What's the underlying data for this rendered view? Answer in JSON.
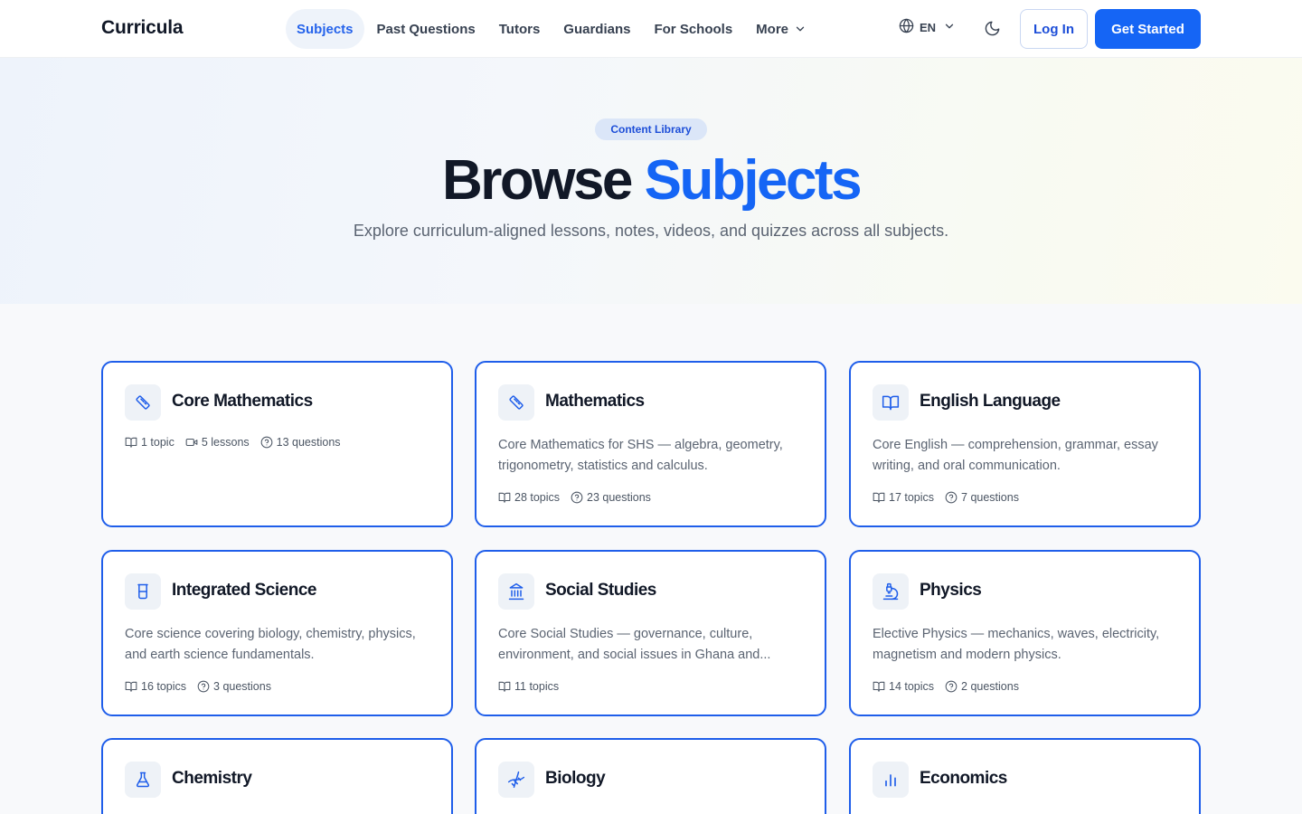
{
  "header": {
    "logo": "Curricula",
    "nav": [
      {
        "label": "Subjects",
        "active": true
      },
      {
        "label": "Past Questions"
      },
      {
        "label": "Tutors"
      },
      {
        "label": "Guardians"
      },
      {
        "label": "For Schools"
      },
      {
        "label": "More",
        "icon": "chevron-down-icon"
      }
    ],
    "language": "EN",
    "login_label": "Log In",
    "get_started_label": "Get Started"
  },
  "hero": {
    "badge": "Content Library",
    "title_part1": "Browse",
    "title_part2": "Subjects",
    "subtitle": "Explore curriculum-aligned lessons, notes, videos, and quizzes across all subjects."
  },
  "subjects": [
    {
      "name": "Core Mathematics",
      "icon": "ruler-icon",
      "description": "",
      "topics": "1 topic",
      "lessons": "5 lessons",
      "questions": "13 questions"
    },
    {
      "name": "Mathematics",
      "icon": "ruler-icon",
      "description": "Core Mathematics for SHS — algebra, geometry, trigonometry, statistics and calculus.",
      "topics": "28 topics",
      "questions": "23 questions"
    },
    {
      "name": "English Language",
      "icon": "book-open-icon",
      "description": "Core English — comprehension, grammar, essay writing, and oral communication.",
      "topics": "17 topics",
      "questions": "7 questions"
    },
    {
      "name": "Integrated Science",
      "icon": "beaker-icon",
      "description": "Core science covering biology, chemistry, physics, and earth science fundamentals.",
      "topics": "16 topics",
      "questions": "3 questions"
    },
    {
      "name": "Social Studies",
      "icon": "landmark-icon",
      "description": "Core Social Studies — governance, culture, environment, and social issues in Ghana and...",
      "topics": "11 topics"
    },
    {
      "name": "Physics",
      "icon": "microscope-icon",
      "description": "Elective Physics — mechanics, waves, electricity, magnetism and modern physics.",
      "topics": "14 topics",
      "questions": "2 questions"
    },
    {
      "name": "Chemistry",
      "icon": "flask-icon"
    },
    {
      "name": "Biology",
      "icon": "dna-icon"
    },
    {
      "name": "Economics",
      "icon": "bar-chart-icon"
    }
  ],
  "colors": {
    "accent": "#1565f5",
    "card_border": "#1f5eea",
    "text": "#111827",
    "muted": "#5b6472"
  }
}
